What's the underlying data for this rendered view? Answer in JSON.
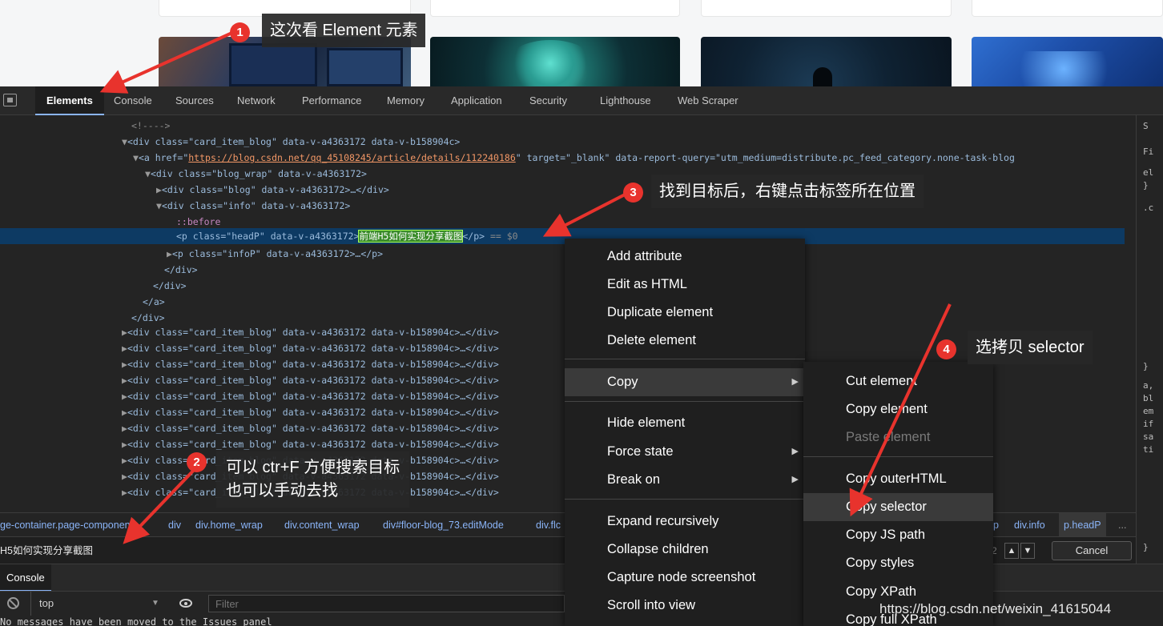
{
  "devtools": {
    "tabs": [
      "Elements",
      "Console",
      "Sources",
      "Network",
      "Performance",
      "Memory",
      "Application",
      "Security",
      "Lighthouse",
      "Web Scraper"
    ],
    "active_tab": "Elements"
  },
  "dom_lines": [
    {
      "text": "<!---->"
    },
    {
      "text": "<div class=\"card_item_blog\" data-v-a4363172 data-v-b158904c>"
    },
    {
      "text_a": "<a href=\"",
      "link": "https://blog.csdn.net/qq_45108245/article/details/112240186",
      "text_b": "\" target=\"_blank\" data-report-query=\"utm_medium=distribute.pc_feed_category.none-task-blog"
    },
    {
      "text": "<div class=\"blog_wrap\" data-v-a4363172>"
    },
    {
      "text": "<div class=\"blog\" data-v-a4363172>…</div>"
    },
    {
      "text": "<div class=\"info\" data-v-a4363172>"
    },
    {
      "text": "::before"
    },
    {
      "text_a": "<p class=\"headP\" data-v-a4363172>",
      "highlight": "前端H5如何实现分享截图",
      "text_b": "</p>",
      "suffix": " == $0"
    },
    {
      "text": "<p class=\"infoP\" data-v-a4363172>…</p>"
    },
    {
      "text": "</div>"
    },
    {
      "text": "</div>"
    },
    {
      "text": "</a>"
    },
    {
      "text": "</div>"
    },
    {
      "text": "<div class=\"card_item_blog\" data-v-a4363172 data-v-b158904c>…</div>"
    }
  ],
  "collapsed_card_line": "<div class=\"card_item_blog\" data-v-a4363172 data-v-b158904c>…</div>",
  "collapsed_card_count": 10,
  "styles_pane": {
    "header": "S",
    "filter": "Fi",
    "frag_1": "el\n}",
    "frag_2": ".c",
    "frag_3": "}",
    "frag_4": "a,\nbl\nem\nif\nsa\nti",
    "frag_5": "}"
  },
  "breadcrumb": [
    "ge-container.page-component",
    "div",
    "div.home_wrap",
    "div.content_wrap",
    "div#floor-blog_73.editMode",
    "div.flc",
    "p",
    "div.info",
    "p.headP",
    "..."
  ],
  "search": {
    "value": "H5如何实现分享截图",
    "count": "2",
    "prev": "▲",
    "next": "▼",
    "cancel_label": "Cancel"
  },
  "console": {
    "tab": "Console",
    "context": "top",
    "filter_placeholder": "Filter",
    "message": "No messages have been moved to the Issues panel"
  },
  "context_menu": {
    "items": [
      {
        "label": "Add attribute"
      },
      {
        "label": "Edit as HTML"
      },
      {
        "label": "Duplicate element"
      },
      {
        "label": "Delete element"
      },
      {
        "label": "Copy",
        "submenu": true
      },
      {
        "label": "Hide element"
      },
      {
        "label": "Force state",
        "submenu": true
      },
      {
        "label": "Break on",
        "submenu": true
      },
      {
        "label": "Expand recursively"
      },
      {
        "label": "Collapse children"
      },
      {
        "label": "Capture node screenshot"
      },
      {
        "label": "Scroll into view"
      }
    ],
    "copy_submenu": [
      {
        "label": "Cut element"
      },
      {
        "label": "Copy element"
      },
      {
        "label": "Paste element"
      },
      {
        "label": "Copy outerHTML"
      },
      {
        "label": "Copy selector"
      },
      {
        "label": "Copy JS path"
      },
      {
        "label": "Copy styles"
      },
      {
        "label": "Copy XPath"
      },
      {
        "label": "Copy full XPath"
      }
    ],
    "submenu_arrow": "▶"
  },
  "annotations": [
    {
      "num": "1",
      "text": "这次看 Element 元素"
    },
    {
      "num": "2",
      "text_line1": "可以 ctr+F 方便搜索目标",
      "text_line2": "也可以手动去找"
    },
    {
      "num": "3",
      "text": "找到目标后，右键点击标签所在位置"
    },
    {
      "num": "4",
      "text": "选拷贝 selector"
    }
  ],
  "watermark": "https://blog.csdn.net/weixin_41615044",
  "colors": {
    "annotation_red": "#e8332d",
    "devtools_bg": "#242424",
    "selected_row": "#0d3a63",
    "link_blue": "#8ab4f8"
  }
}
